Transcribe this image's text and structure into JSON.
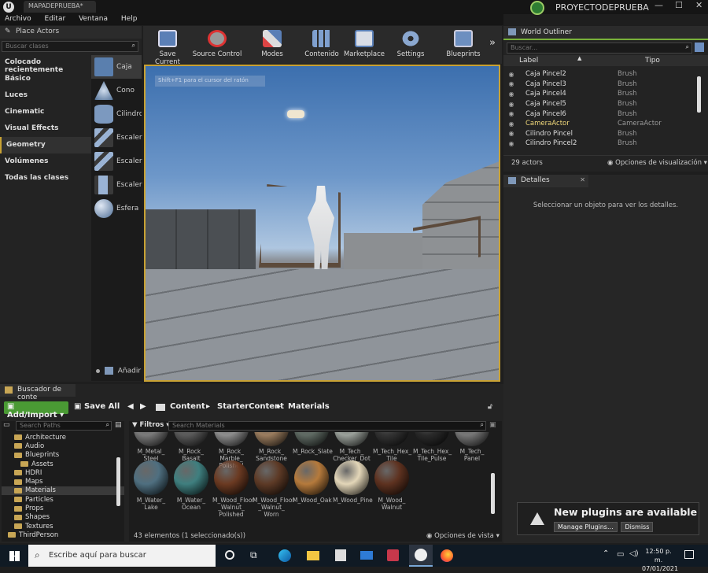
{
  "window": {
    "doc_tab": "MAPADEPRUEBA*",
    "project": "PROYECTODEPRUEBA"
  },
  "menu": [
    "Archivo",
    "Editar",
    "Ventana",
    "Help"
  ],
  "place_actors": {
    "title": "Place Actors",
    "search_placeholder": "Buscar clases",
    "categories": [
      {
        "label": "Colocado recientemente"
      },
      {
        "label": "Básico"
      },
      {
        "label": "Luces"
      },
      {
        "label": "Cinematic"
      },
      {
        "label": "Visual Effects"
      },
      {
        "label": "Geometry"
      },
      {
        "label": "Volúmenes"
      },
      {
        "label": "Todas las clases"
      }
    ],
    "assets": [
      {
        "label": "Caja"
      },
      {
        "label": "Cono"
      },
      {
        "label": "Cilindro"
      },
      {
        "label": "Escaler"
      },
      {
        "label": "Escaler"
      },
      {
        "label": "Escaler"
      },
      {
        "label": "Esfera"
      }
    ],
    "add_label": "Añadir"
  },
  "toolbar": [
    {
      "label": "Save Current"
    },
    {
      "label": "Source Control"
    },
    {
      "label": "Modes"
    },
    {
      "label": "Contenido"
    },
    {
      "label": "Marketplace"
    },
    {
      "label": "Settings"
    },
    {
      "label": "Blueprints"
    }
  ],
  "viewport": {
    "hint": "Shift+F1 para el cursor del ratón"
  },
  "outliner": {
    "title": "World Outliner",
    "search_placeholder": "Buscar...",
    "col_label": "Label",
    "col_type": "Tipo",
    "rows": [
      {
        "label": "Caja Pincel2",
        "type": "Brush"
      },
      {
        "label": "Caja Pincel3",
        "type": "Brush"
      },
      {
        "label": "Caja Pincel4",
        "type": "Brush"
      },
      {
        "label": "Caja Pincel5",
        "type": "Brush"
      },
      {
        "label": "Caja Pincel6",
        "type": "Brush"
      },
      {
        "label": "CameraActor",
        "type": "CameraActor"
      },
      {
        "label": "Cilindro Pincel",
        "type": "Brush"
      },
      {
        "label": "Cilindro Pincel2",
        "type": "Brush"
      }
    ],
    "count": "29 actors",
    "view_options": "Opciones de visualización"
  },
  "details": {
    "title": "Detalles",
    "empty_msg": "Seleccionar un objeto para ver los detalles."
  },
  "content_browser": {
    "title": "Buscador de conte",
    "add_import": "Add/Import",
    "save_all": "Save All",
    "breadcrumb": [
      "Content",
      "StarterContent",
      "Materials"
    ],
    "search_paths": "Search Paths",
    "filters": "Filtros",
    "search_materials": "Search Materials",
    "folders": [
      {
        "label": "Architecture",
        "indent": 2
      },
      {
        "label": "Audio",
        "indent": 2
      },
      {
        "label": "Blueprints",
        "indent": 2
      },
      {
        "label": "Assets",
        "indent": 3
      },
      {
        "label": "HDRI",
        "indent": 2
      },
      {
        "label": "Maps",
        "indent": 2
      },
      {
        "label": "Materials",
        "indent": 2
      },
      {
        "label": "Particles",
        "indent": 2
      },
      {
        "label": "Props",
        "indent": 2
      },
      {
        "label": "Shapes",
        "indent": 2
      },
      {
        "label": "Textures",
        "indent": 2
      },
      {
        "label": "ThirdPerson",
        "indent": 1
      }
    ],
    "row1": [
      {
        "name": "M_Metal_ Steel",
        "color": "#7a7a7a"
      },
      {
        "name": "M_Rock_ Basalt",
        "color": "#5a5a5a"
      },
      {
        "name": "M_Rock_ Marble_ Polished",
        "color": "#8d8d8d"
      },
      {
        "name": "M_Rock_ Sandstone",
        "color": "#9a7c5e"
      },
      {
        "name": "M_Rock_Slate",
        "color": "#5f6a63"
      },
      {
        "name": "M_Tech_ Checker_Dot",
        "color": "#9aa09a"
      },
      {
        "name": "M_Tech_Hex_ Tile",
        "color": "#333"
      },
      {
        "name": "M_Tech_Hex_ Tile_Pulse",
        "color": "#2a2a2a"
      },
      {
        "name": "M_Tech_ Panel",
        "color": "#777"
      }
    ],
    "row2": [
      {
        "name": "M_Water_ Lake",
        "color": "#4f6f80"
      },
      {
        "name": "M_Water_ Ocean",
        "color": "#3f7f7f"
      },
      {
        "name": "M_Wood_Floor _Walnut_ Polished",
        "color": "#6b3a22"
      },
      {
        "name": "M_Wood_Floor _Walnut_ Worn",
        "color": "#5d3a26"
      },
      {
        "name": "M_Wood_Oak",
        "color": "#b57a3c"
      },
      {
        "name": "M_Wood_Pine",
        "color": "#e3d6b8"
      },
      {
        "name": "M_Wood_ Walnut",
        "color": "#5e3220"
      }
    ],
    "status": "43 elementos (1 seleccionado(s))",
    "view_options": "Opciones de vista"
  },
  "notification": {
    "title": "New plugins are available",
    "manage": "Manage Plugins...",
    "dismiss": "Dismiss"
  },
  "taskbar": {
    "search": "Escribe aquí para buscar",
    "time": "12:50 p. m.",
    "date": "07/01/2021"
  }
}
